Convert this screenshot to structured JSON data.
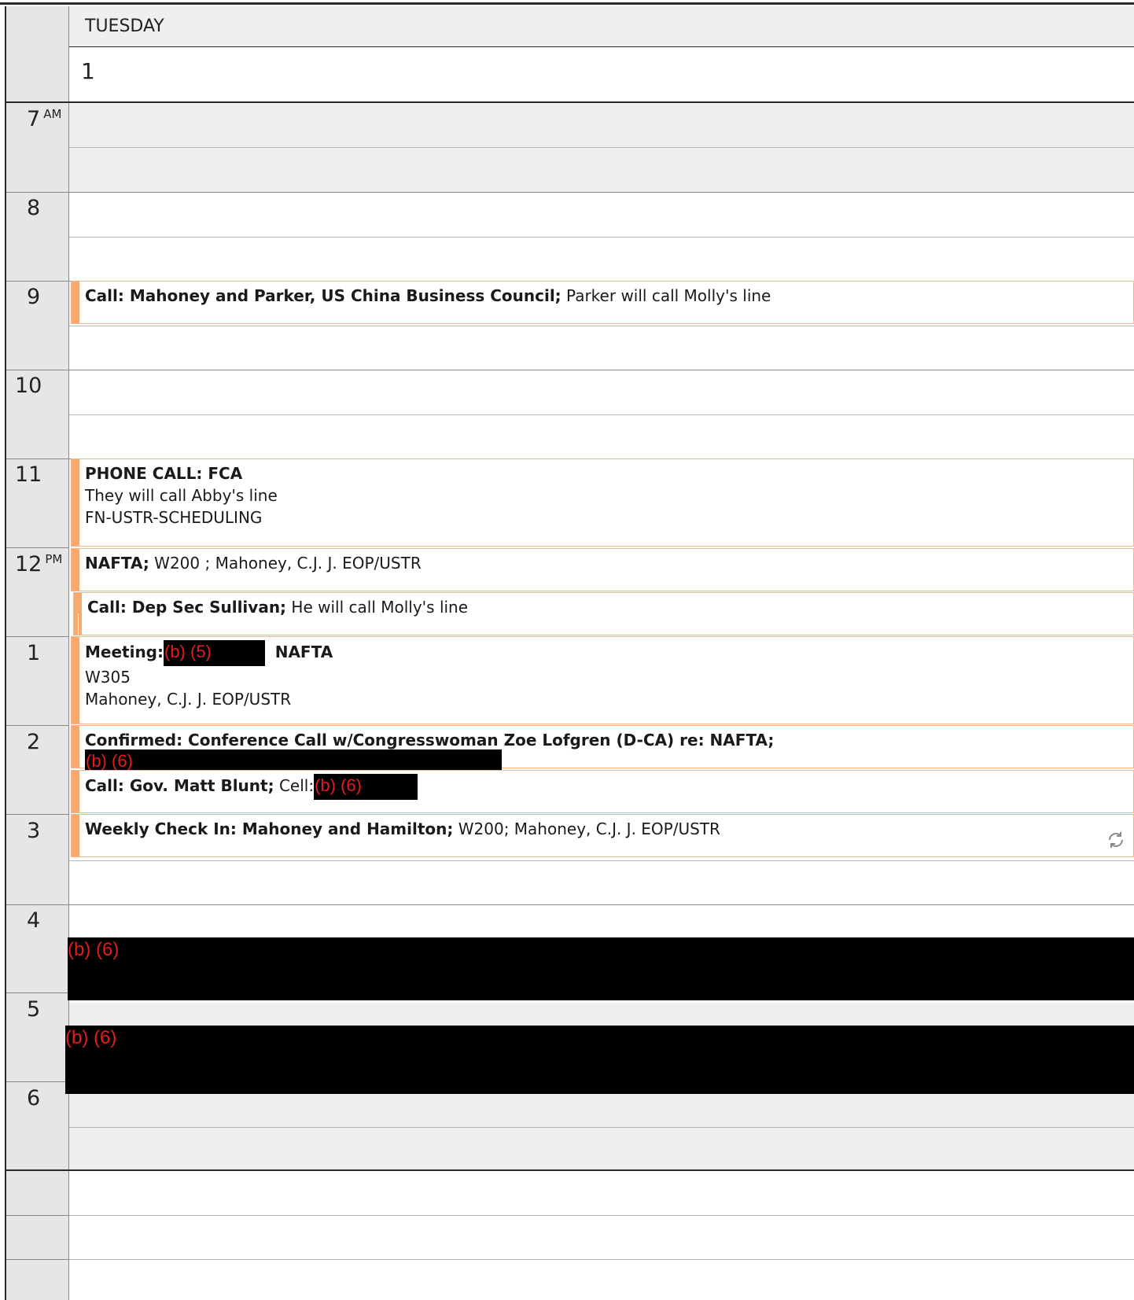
{
  "day": {
    "name": "TUESDAY",
    "date": "1"
  },
  "hours": [
    {
      "label": "7",
      "suffix": "AM"
    },
    {
      "label": "8",
      "suffix": ""
    },
    {
      "label": "9",
      "suffix": ""
    },
    {
      "label": "10",
      "suffix": ""
    },
    {
      "label": "11",
      "suffix": ""
    },
    {
      "label": "12",
      "suffix": "PM"
    },
    {
      "label": "1",
      "suffix": ""
    },
    {
      "label": "2",
      "suffix": ""
    },
    {
      "label": "3",
      "suffix": ""
    },
    {
      "label": "4",
      "suffix": ""
    },
    {
      "label": "5",
      "suffix": ""
    },
    {
      "label": "6",
      "suffix": ""
    }
  ],
  "appointments": {
    "call_china": {
      "title": "Call: Mahoney and Parker, US China Business Council;",
      "detail": " Parker will call Molly's line"
    },
    "phone_fca": {
      "title": "PHONE CALL: FCA",
      "line1": "They will call Abby's line",
      "line2": "FN-USTR-SCHEDULING"
    },
    "nafta": {
      "title": "NAFTA;",
      "detail": " W200 ; Mahoney, C.J. J. EOP/USTR"
    },
    "sullivan": {
      "title": "Call: Dep Sec Sullivan;",
      "detail": " He will call Molly's line"
    },
    "meeting": {
      "title": "Meeting:",
      "redaction": "(b) (5)",
      "title2": "NAFTA",
      "line1": "W305",
      "line2": "Mahoney, C.J. J. EOP/USTR"
    },
    "lofgren": {
      "title": "Confirmed:  Conference Call w/Congresswoman Zoe Lofgren (D-CA) re: NAFTA;",
      "redaction": "(b) (6)"
    },
    "blunt": {
      "title": "Call: Gov. Matt Blunt;",
      "detail": " Cell:",
      "redaction": "(b) (6)"
    },
    "weekly": {
      "title": "Weekly Check In: Mahoney and Hamilton;",
      "detail": " W200; Mahoney, C.J. J. EOP/USTR"
    }
  },
  "redactions": {
    "four_pm": "(b) (6)",
    "five_pm": "(b) (6)"
  },
  "colors": {
    "accent": "#f7a96f",
    "appt_border": "#f6b48a",
    "redaction_text": "#e51c1c",
    "offhours_bg": "#efefef"
  }
}
